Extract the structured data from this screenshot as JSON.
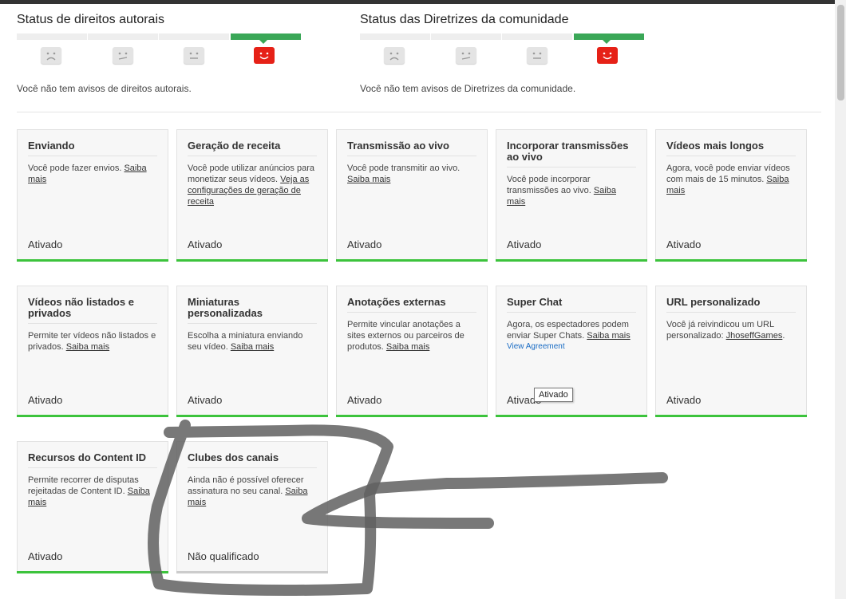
{
  "copyright": {
    "title": "Status de direitos autorais",
    "note": "Você não tem avisos de direitos autorais."
  },
  "community": {
    "title": "Status das Diretrizes da comunidade",
    "note": "Você não tem avisos de Diretrizes da comunidade."
  },
  "colors": {
    "active": "#3aa757",
    "card_on": "#3cc33c",
    "face_active": "#e62117"
  },
  "cards": [
    {
      "title": "Enviando",
      "desc": "Você pode fazer envios. ",
      "link": "Saiba mais",
      "extra": "",
      "status": "Ativado"
    },
    {
      "title": "Geração de receita",
      "desc": "Você pode utilizar anúncios para monetizar seus vídeos. ",
      "link": "Veja as configurações de geração de receita",
      "extra": "",
      "status": "Ativado"
    },
    {
      "title": "Transmissão ao vivo",
      "desc": "Você pode transmitir ao vivo. ",
      "link": "Saiba mais",
      "extra": "",
      "status": "Ativado"
    },
    {
      "title": "Incorporar transmissões ao vivo",
      "desc": "Você pode incorporar transmissões ao vivo. ",
      "link": "Saiba mais",
      "extra": "",
      "status": "Ativado"
    },
    {
      "title": "Vídeos mais longos",
      "desc": "Agora, você pode enviar vídeos com mais de 15 minutos. ",
      "link": "Saiba mais",
      "extra": "",
      "status": "Ativado"
    },
    {
      "title": "Vídeos não listados e privados",
      "desc": "Permite ter vídeos não listados e privados. ",
      "link": "Saiba mais",
      "extra": "",
      "status": "Ativado"
    },
    {
      "title": "Miniaturas personalizadas",
      "desc": "Escolha a miniatura enviando seu vídeo. ",
      "link": "Saiba mais",
      "extra": "",
      "status": "Ativado"
    },
    {
      "title": "Anotações externas",
      "desc": "Permite vincular anotações a sites externos ou parceiros de produtos. ",
      "link": "Saiba mais",
      "extra": "",
      "status": "Ativado"
    },
    {
      "title": "Super Chat",
      "desc": "Agora, os espectadores podem enviar Super Chats. ",
      "link": "Saiba mais",
      "extra": "View Agreement",
      "status": "Ativado"
    },
    {
      "title": "URL personalizado",
      "desc": "Você já reivindicou um URL personalizado: ",
      "link": "JhoseffGames",
      "extra": "",
      "status": "Ativado"
    },
    {
      "title": "Recursos do Content ID",
      "desc": "Permite recorrer de disputas rejeitadas de Content ID. ",
      "link": "Saiba mais",
      "extra": "",
      "status": "Ativado"
    },
    {
      "title": "Clubes dos canais",
      "desc": "Ainda não é possível oferecer assinatura no seu canal. ",
      "link": "Saiba mais",
      "extra": "",
      "status": "Não qualificado"
    }
  ],
  "tooltip": "Ativado"
}
